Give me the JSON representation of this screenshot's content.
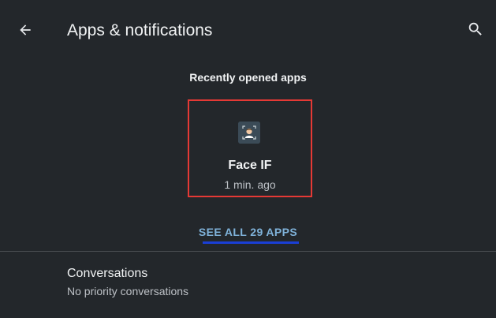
{
  "toolbar": {
    "title": "Apps & notifications",
    "back_icon": "arrow-back-icon",
    "search_icon": "search-icon"
  },
  "recent": {
    "header": "Recently opened apps",
    "apps": [
      {
        "name": "Face IF",
        "time": "1 min. ago",
        "icon": "face-app-icon"
      }
    ],
    "see_all_label": "SEE ALL 29 APPS"
  },
  "conversations": {
    "title": "Conversations",
    "subtitle": "No priority conversations"
  },
  "colors": {
    "background": "#23272b",
    "highlight_border": "#e53935",
    "link": "#7fb2d9",
    "link_underline": "#1a3fd6"
  }
}
